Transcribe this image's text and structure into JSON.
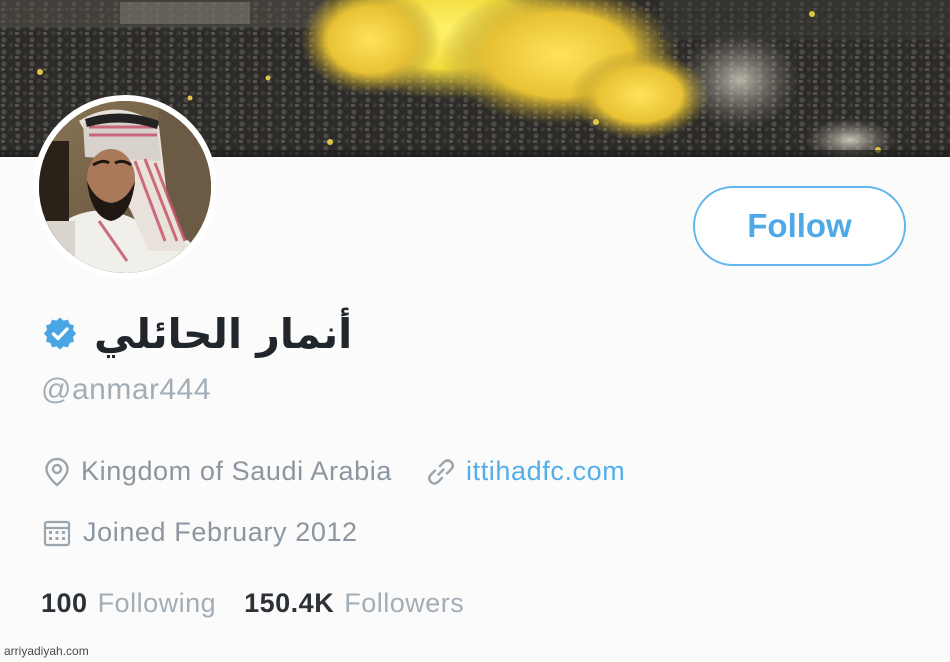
{
  "profile": {
    "display_name": "أنمار الحائلي",
    "handle": "@anmar444",
    "verified": true,
    "location": "Kingdom of Saudi Arabia",
    "website": "ittihadfc.com",
    "joined": "Joined February 2012"
  },
  "actions": {
    "follow_label": "Follow"
  },
  "stats": {
    "following_count": "100",
    "following_label": "Following",
    "followers_count": "150.4K",
    "followers_label": "Followers"
  },
  "watermark": "arriyadiyah.com",
  "icons": {
    "verified": "verified-badge-icon",
    "location": "location-pin-icon",
    "website": "link-icon",
    "joined": "calendar-icon"
  },
  "colors": {
    "accent": "#4fa9e6",
    "verified": "#4aa6e3",
    "muted_text": "#8b96a0",
    "name_text": "#20262c"
  }
}
